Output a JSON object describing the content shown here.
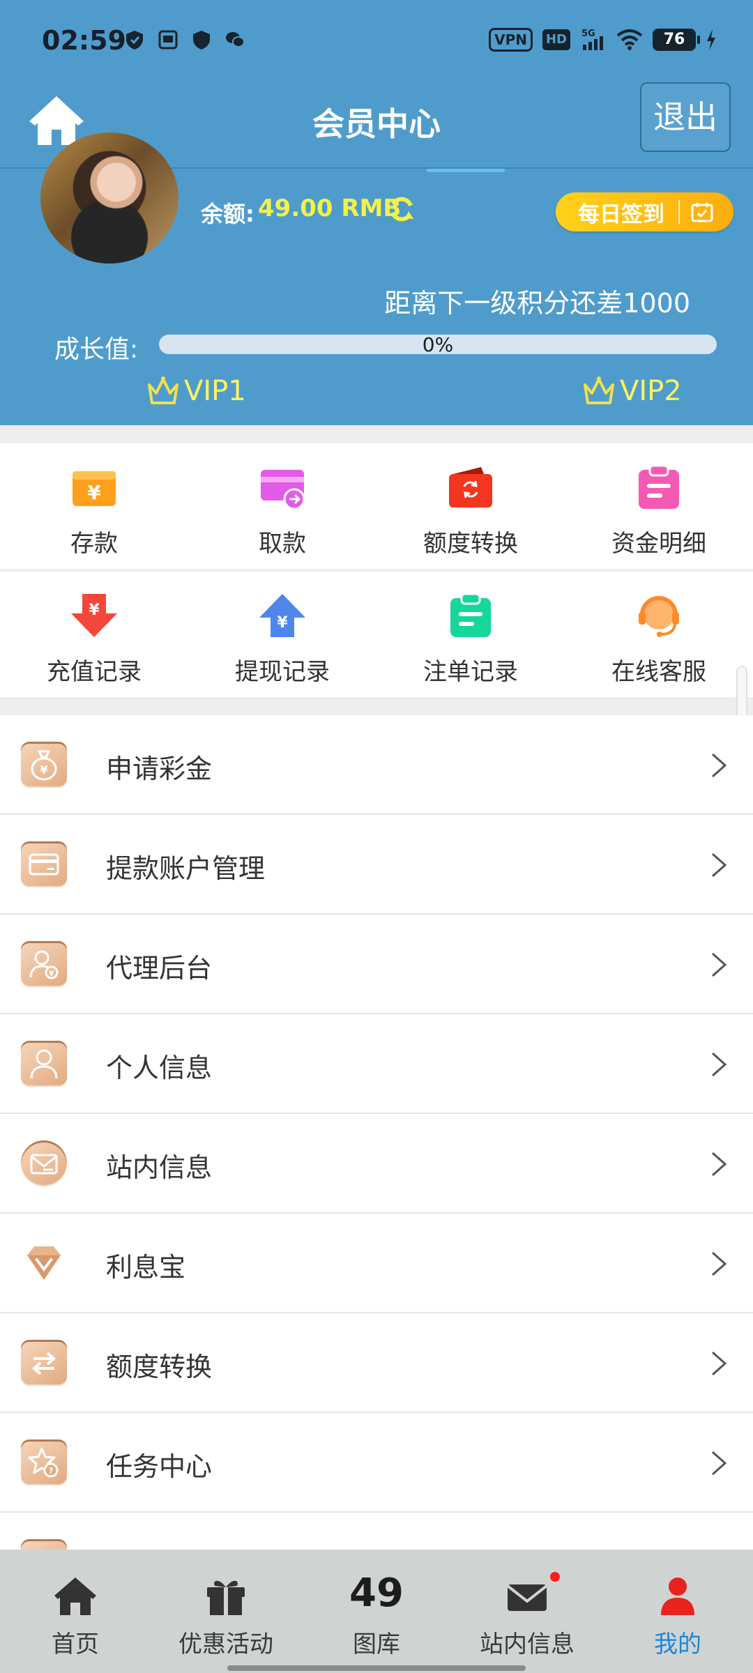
{
  "status_bar": {
    "time": "02:59",
    "vpn": "VPN",
    "hd": "HD",
    "network": "5G",
    "battery": "76"
  },
  "header": {
    "title": "会员中心",
    "logout": "退出"
  },
  "profile": {
    "balance_label": "余额:",
    "balance_value": "49.00 RMB",
    "daily_signin": "每日签到",
    "next_level_text": "距离下一级积分还差1000",
    "growth_label": "成长值:",
    "progress_text": "0%",
    "progress_fraction": 0,
    "current_vip": "VIP1",
    "next_vip": "VIP2"
  },
  "quick_actions": {
    "row1": [
      {
        "label": "存款",
        "icon": "deposit-wallet-icon",
        "color": "#ff9f1c"
      },
      {
        "label": "取款",
        "icon": "withdraw-card-icon",
        "color": "#e35be6"
      },
      {
        "label": "额度转换",
        "icon": "transfer-wallet-icon",
        "color": "#f2361f"
      },
      {
        "label": "资金明细",
        "icon": "fund-details-clipboard-icon",
        "color": "#f45ab4"
      }
    ],
    "row2": [
      {
        "label": "充值记录",
        "icon": "recharge-record-arrow-icon",
        "color": "#f5463a"
      },
      {
        "label": "提现记录",
        "icon": "withdraw-record-arrow-icon",
        "color": "#4e86ec"
      },
      {
        "label": "注单记录",
        "icon": "bet-record-clipboard-icon",
        "color": "#17d69b"
      },
      {
        "label": "在线客服",
        "icon": "customer-service-headset-icon",
        "color": "#ff9a45"
      }
    ]
  },
  "menu": [
    {
      "label": "申请彩金",
      "icon": "money-bag-icon"
    },
    {
      "label": "提款账户管理",
      "icon": "bank-card-icon"
    },
    {
      "label": "代理后台",
      "icon": "agent-user-icon"
    },
    {
      "label": "个人信息",
      "icon": "person-icon"
    },
    {
      "label": "站内信息",
      "icon": "mail-icon"
    },
    {
      "label": "利息宝",
      "icon": "diamond-icon"
    },
    {
      "label": "额度转换",
      "icon": "transfer-arrows-icon"
    },
    {
      "label": "任务中心",
      "icon": "task-star-icon"
    }
  ],
  "bottom_nav": [
    {
      "label": "首页",
      "icon": "home-icon"
    },
    {
      "label": "优惠活动",
      "icon": "gift-icon"
    },
    {
      "label": "图库",
      "number": "49"
    },
    {
      "label": "站内信息",
      "icon": "mail-icon"
    },
    {
      "label": "我的",
      "icon": "user-icon",
      "active": true
    }
  ],
  "colors": {
    "header_bg": "#4f9ccc",
    "accent_yellow": "#f3f14a",
    "active_nav": "#1e86d9",
    "nav_bg": "#cfd4d3"
  }
}
